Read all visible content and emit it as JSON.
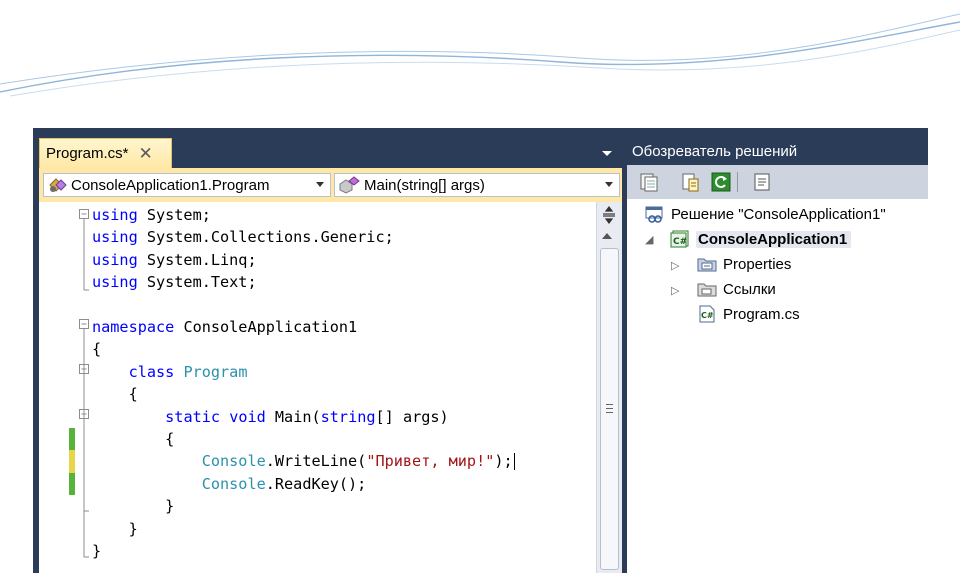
{
  "editor": {
    "tab": {
      "title": "Program.cs*",
      "close_glyph": "✕"
    },
    "navigation": {
      "type_selector": "ConsoleApplication1.Program",
      "member_selector": "Main(string[] args)"
    },
    "code_lines": [
      {
        "tokens": [
          {
            "text": "using",
            "kind": "kw"
          },
          {
            "text": " System;",
            "kind": "plain"
          }
        ]
      },
      {
        "tokens": [
          {
            "text": "using",
            "kind": "kw"
          },
          {
            "text": " System.Collections.Generic;",
            "kind": "plain"
          }
        ]
      },
      {
        "tokens": [
          {
            "text": "using",
            "kind": "kw"
          },
          {
            "text": " System.Linq;",
            "kind": "plain"
          }
        ]
      },
      {
        "tokens": [
          {
            "text": "using",
            "kind": "kw"
          },
          {
            "text": " System.Text;",
            "kind": "plain"
          }
        ]
      },
      {
        "tokens": []
      },
      {
        "tokens": [
          {
            "text": "namespace",
            "kind": "kw"
          },
          {
            "text": " ConsoleApplication1",
            "kind": "plain"
          }
        ]
      },
      {
        "tokens": [
          {
            "text": "{",
            "kind": "plain"
          }
        ]
      },
      {
        "tokens": [
          {
            "text": "    ",
            "kind": "plain"
          },
          {
            "text": "class",
            "kind": "kw"
          },
          {
            "text": " ",
            "kind": "plain"
          },
          {
            "text": "Program",
            "kind": "ty"
          }
        ]
      },
      {
        "tokens": [
          {
            "text": "    {",
            "kind": "plain"
          }
        ]
      },
      {
        "tokens": [
          {
            "text": "        ",
            "kind": "plain"
          },
          {
            "text": "static",
            "kind": "kw"
          },
          {
            "text": " ",
            "kind": "plain"
          },
          {
            "text": "void",
            "kind": "kw"
          },
          {
            "text": " Main(",
            "kind": "plain"
          },
          {
            "text": "string",
            "kind": "kw"
          },
          {
            "text": "[] args)",
            "kind": "plain"
          }
        ]
      },
      {
        "tokens": [
          {
            "text": "        {",
            "kind": "plain"
          }
        ]
      },
      {
        "tokens": [
          {
            "text": "            ",
            "kind": "plain"
          },
          {
            "text": "Console",
            "kind": "ty"
          },
          {
            "text": ".WriteLine(",
            "kind": "plain"
          },
          {
            "text": "\"Привет, мир!\"",
            "kind": "st"
          },
          {
            "text": ");",
            "kind": "plain"
          }
        ],
        "caret": true
      },
      {
        "tokens": [
          {
            "text": "            ",
            "kind": "plain"
          },
          {
            "text": "Console",
            "kind": "ty"
          },
          {
            "text": ".ReadKey();",
            "kind": "plain"
          }
        ]
      },
      {
        "tokens": [
          {
            "text": "        }",
            "kind": "plain"
          }
        ]
      },
      {
        "tokens": [
          {
            "text": "    }",
            "kind": "plain"
          }
        ]
      },
      {
        "tokens": [
          {
            "text": "}",
            "kind": "plain"
          }
        ]
      }
    ],
    "change_markers": [
      {
        "line": 11,
        "status": "saved",
        "color": "#57b33a"
      },
      {
        "line": 12,
        "status": "unsaved",
        "color": "#e7d54a"
      },
      {
        "line": 13,
        "status": "saved",
        "color": "#57b33a"
      }
    ],
    "colors": {
      "keyword": "#0000ff",
      "type": "#2b91af",
      "string": "#a31515"
    }
  },
  "solution_explorer": {
    "title": "Обозреватель решений",
    "toolbar_icons": [
      "show-all-files-icon",
      "properties-icon",
      "refresh-icon",
      "view-class-diagram-icon"
    ],
    "solution": "Решение \"ConsoleApplication1\"",
    "project": "ConsoleApplication1",
    "items": [
      {
        "label": "Properties",
        "icon": "properties-folder-icon",
        "expandable": true
      },
      {
        "label": "Ссылки",
        "icon": "references-folder-icon",
        "expandable": true
      },
      {
        "label": "Program.cs",
        "icon": "csharp-file-icon",
        "expandable": false
      }
    ]
  }
}
